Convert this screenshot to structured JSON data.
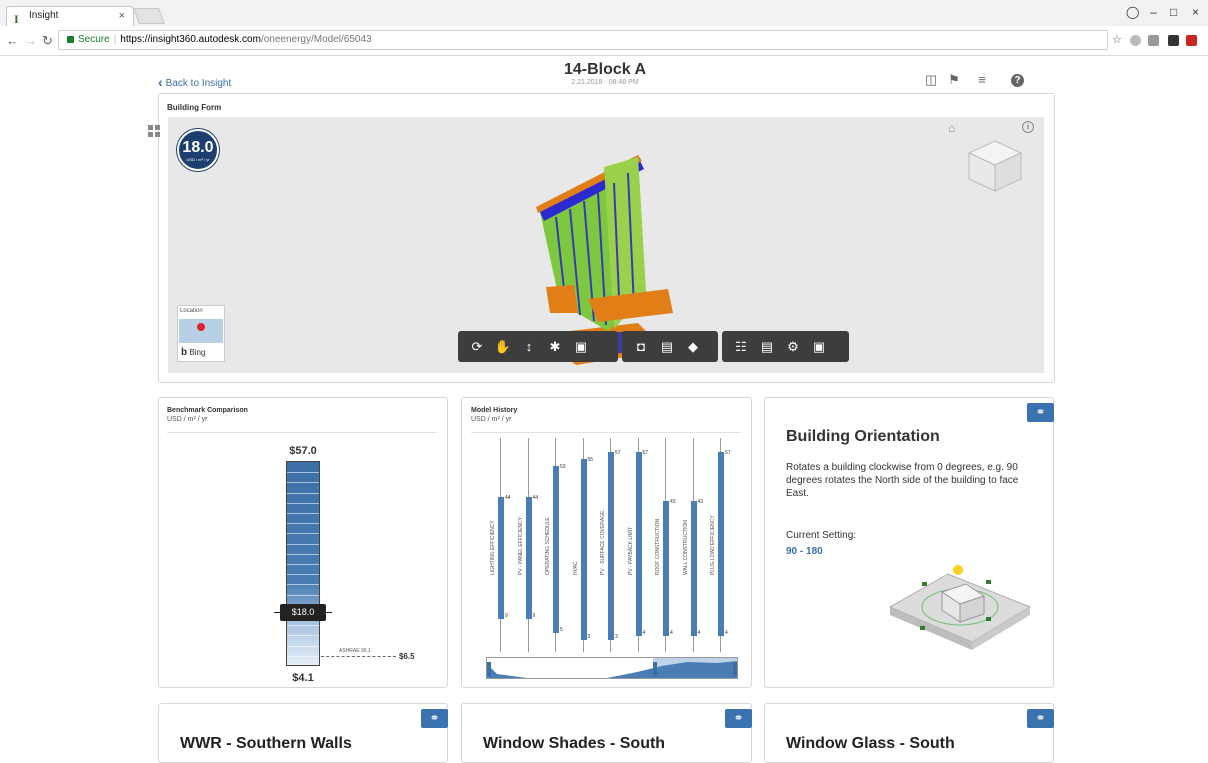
{
  "browser": {
    "tab_title": "Insight",
    "tab_close": "×",
    "secure_label": "Secure",
    "url_host": "https://insight360.autodesk.com",
    "url_path": "/oneenergy/Model/65043"
  },
  "header": {
    "back_label": "Back to Insight",
    "model_title": "14-Block A",
    "model_date": "2.21.2018 · 08:48 PM"
  },
  "building_form": {
    "label": "Building Form",
    "score_value": "18.0",
    "score_unit": "USD / m² / yr",
    "location_label": "Location",
    "bing_label": "Bing"
  },
  "benchmark": {
    "title": "Benchmark Comparison",
    "unit": "USD / m² / yr",
    "top_value": "$57.0",
    "current_value": "$18.0",
    "ashrae_label": "ASHRAE 90.1",
    "ashrae_value": "$6.5",
    "bottom_value": "$4.1",
    "levels": {
      "top": 57.0,
      "current": 18.0,
      "ashrae": 6.5,
      "bottom": 4.1
    }
  },
  "model_history": {
    "title": "Model History",
    "unit": "USD / m² / yr",
    "factors": [
      {
        "label": "LIGHTING EFFICIENCY",
        "max": "44",
        "min": "9",
        "max_v": 44,
        "min_v": 9
      },
      {
        "label": "PV - PANEL EFFICIENCY",
        "max": "44",
        "min": "9",
        "max_v": 44,
        "min_v": 9
      },
      {
        "label": "OPERATING SCHEDULE",
        "max": "53",
        "min": "5",
        "max_v": 53,
        "min_v": 5
      },
      {
        "label": "HVAC",
        "max": "55",
        "min": "3",
        "max_v": 55,
        "min_v": 3
      },
      {
        "label": "PV - SURFACE COVERAGE",
        "max": "57",
        "min": "3",
        "max_v": 57,
        "min_v": 3
      },
      {
        "label": "PV - PAYBACK LIMIT",
        "max": "57",
        "min": "4",
        "max_v": 57,
        "min_v": 4
      },
      {
        "label": "ROOF CONSTRUCTION",
        "max": "43",
        "min": "4",
        "max_v": 43,
        "min_v": 4
      },
      {
        "label": "WALL CONSTRUCTION",
        "max": "43",
        "min": "4",
        "max_v": 43,
        "min_v": 4
      },
      {
        "label": "PLUG LOAD EFFICIENCY",
        "max": "57",
        "min": "4",
        "max_v": 57,
        "min_v": 4
      }
    ]
  },
  "orientation": {
    "title": "Building Orientation",
    "description": "Rotates a building clockwise from 0 degrees, e.g. 90 degrees rotates the North side of the building to face East.",
    "setting_label": "Current Setting:",
    "setting_value": "90 - 180"
  },
  "bottom_cards": [
    {
      "title": "WWR - Southern Walls"
    },
    {
      "title": "Window Shades - South"
    },
    {
      "title": "Window Glass - South"
    }
  ],
  "colors": {
    "accent": "#3b73b0",
    "score_bg": "#1c3f70"
  }
}
